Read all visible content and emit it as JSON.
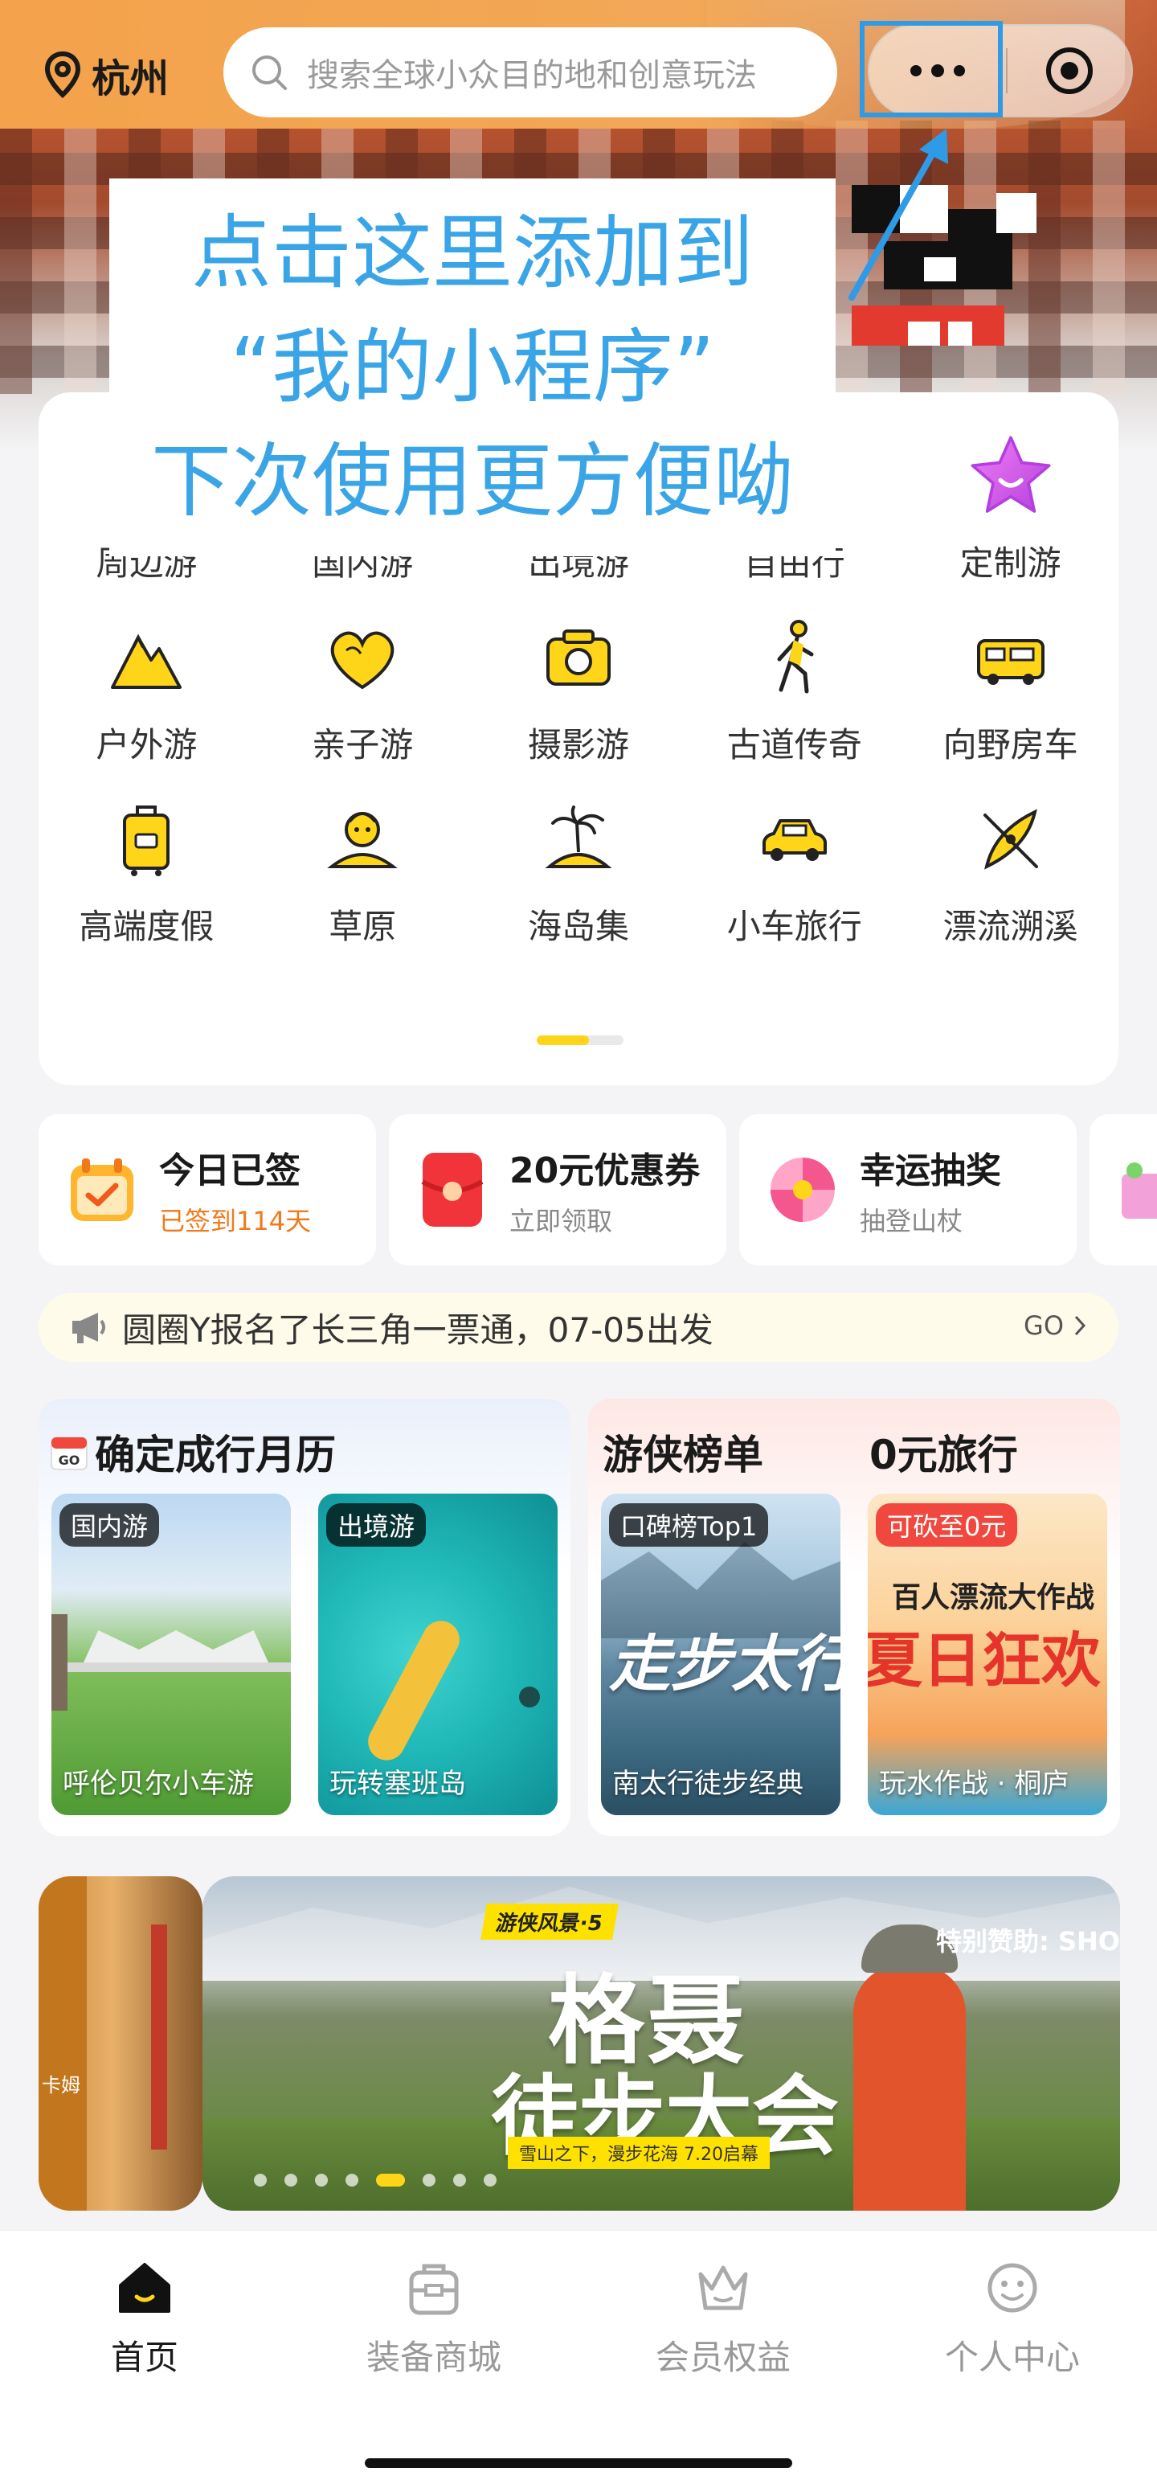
{
  "header": {
    "city": "杭州",
    "search_placeholder": "搜索全球小众目的地和创意玩法"
  },
  "tooltip": {
    "lines": [
      "点击这里添加到",
      "“我的小程序”",
      "下次使用更方便呦"
    ]
  },
  "categories": [
    {
      "label": "周边游",
      "icon": "nearby-trip-icon"
    },
    {
      "label": "国内游",
      "icon": "domestic-trip-icon"
    },
    {
      "label": "出境游",
      "icon": "outbound-trip-icon"
    },
    {
      "label": "自由行",
      "icon": "free-travel-icon"
    },
    {
      "label": "定制游",
      "icon": "star-icon"
    },
    {
      "label": "户外游",
      "icon": "mountain-icon"
    },
    {
      "label": "亲子游",
      "icon": "heart-icon"
    },
    {
      "label": "摄影游",
      "icon": "camera-icon"
    },
    {
      "label": "古道传奇",
      "icon": "hiker-icon"
    },
    {
      "label": "向野房车",
      "icon": "rv-icon"
    },
    {
      "label": "高端度假",
      "icon": "luggage-icon"
    },
    {
      "label": "草原",
      "icon": "grassland-person-icon"
    },
    {
      "label": "海岛集",
      "icon": "island-icon"
    },
    {
      "label": "小车旅行",
      "icon": "car-icon"
    },
    {
      "label": "漂流溯溪",
      "icon": "kayak-icon"
    }
  ],
  "category_pager": {
    "active_fraction": 0.6
  },
  "quick_cards": [
    {
      "title": "今日已签",
      "subtitle": "已签到114天",
      "icon": "calendar-check-icon"
    },
    {
      "title": "20元优惠券",
      "subtitle": "立即领取",
      "icon": "red-packet-icon"
    },
    {
      "title": "幸运抽奖",
      "subtitle": "抽登山杖",
      "icon": "lottery-wheel-icon"
    }
  ],
  "notice": {
    "icon": "megaphone-icon",
    "text": "圆圈Y报名了长三角一票通，07-05出发",
    "go_label": "GO"
  },
  "sections": {
    "left": {
      "title": "确定成行月历",
      "tiles": [
        {
          "tag": "国内游",
          "name": "呼伦贝尔小车游"
        },
        {
          "tag": "出境游",
          "name": "玩转塞班岛"
        }
      ]
    },
    "right": {
      "title1": "游侠榜单",
      "title2": "0元旅行",
      "tiles": [
        {
          "tag": "口碑榜Top1",
          "name": "南太行徒步经典"
        },
        {
          "tag": "可砍至0元",
          "name": "玩水作战 · 桐庐"
        }
      ]
    }
  },
  "banner": {
    "badge": "游侠风景·5",
    "title_line1": "格聂",
    "title_line2": "徒步大会",
    "strip": "雪山之下，漫步花海 7.20启幕",
    "sponsor": "特别赞助: SHO",
    "side_text": "卡姆",
    "dots_count": 8,
    "active_dot": 5
  },
  "tabbar": [
    {
      "label": "首页",
      "icon": "home-icon",
      "active": true
    },
    {
      "label": "装备商城",
      "icon": "shop-icon",
      "active": false
    },
    {
      "label": "会员权益",
      "icon": "crown-icon",
      "active": false
    },
    {
      "label": "个人中心",
      "icon": "smile-icon",
      "active": false
    }
  ],
  "colors": {
    "accent_yellow": "#ffd51a",
    "header_orange": "#f4a24b",
    "tooltip_blue": "#3aa5e6",
    "signin_orange": "#f07a1a",
    "badge_red": "#f0483e"
  }
}
